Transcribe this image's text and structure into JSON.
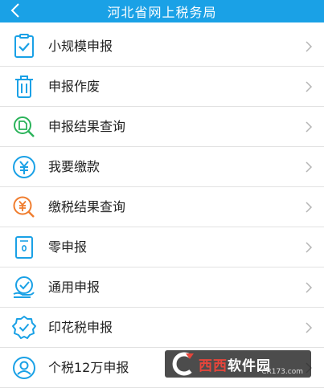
{
  "header": {
    "title": "河北省网上税务局"
  },
  "menu": [
    {
      "label": "小规模申报",
      "icon": "checklist-icon"
    },
    {
      "label": "申报作废",
      "icon": "trash-icon"
    },
    {
      "label": "申报结果查询",
      "icon": "document-search-icon"
    },
    {
      "label": "我要缴款",
      "icon": "yuan-icon"
    },
    {
      "label": "缴税结果查询",
      "icon": "yuan-search-icon"
    },
    {
      "label": "零申报",
      "icon": "zero-document-icon"
    },
    {
      "label": "通用申报",
      "icon": "hand-check-icon"
    },
    {
      "label": "印花税申报",
      "icon": "stamp-badge-icon"
    },
    {
      "label": "个税12万申报",
      "icon": "person-icon"
    }
  ],
  "watermark": {
    "text_a": "西西",
    "text_b": "软件园",
    "url": "CR173.com"
  },
  "colors": {
    "header": "#1aa1e6",
    "icon_blue": "#1aa1e6",
    "icon_green": "#2bb35a",
    "icon_orange": "#f07d2e"
  }
}
